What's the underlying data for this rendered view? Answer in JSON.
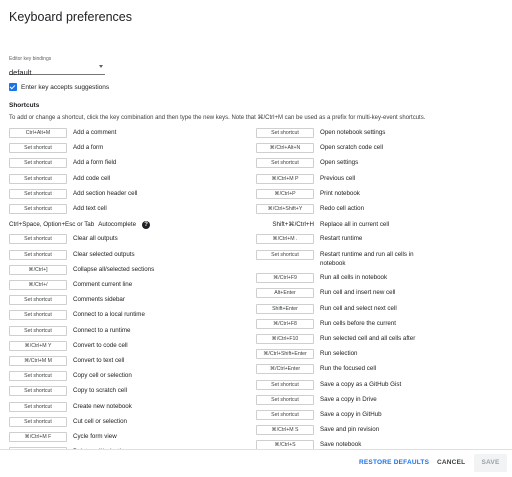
{
  "dialog": {
    "title": "Keyboard preferences",
    "editor_bindings_label": "Editor key bindings",
    "editor_bindings_value": "default",
    "suggestions_label": "Enter key accepts suggestions",
    "shortcuts_heading": "Shortcuts",
    "instructions": "To add or change a shortcut, click the key combination and then type the new keys. Note that ⌘/Ctrl+M can be used as a prefix for multi-key-event shortcuts."
  },
  "left_shortcuts": [
    {
      "key": "Ctrl+Alt+M",
      "label": "Add a comment"
    },
    {
      "key": "Set shortcut",
      "label": "Add a form"
    },
    {
      "key": "Set shortcut",
      "label": "Add a form field"
    },
    {
      "key": "Set shortcut",
      "label": "Add code cell"
    },
    {
      "key": "Set shortcut",
      "label": "Add section header cell"
    },
    {
      "key": "Set shortcut",
      "label": "Add text cell"
    }
  ],
  "autocomplete": {
    "key": "Ctrl+Space, Option+Esc or Tab",
    "label": "Autocomplete"
  },
  "left_shortcuts_2": [
    {
      "key": "Set shortcut",
      "label": "Clear all outputs"
    },
    {
      "key": "Set shortcut",
      "label": "Clear selected outputs"
    },
    {
      "key": "⌘/Ctrl+]",
      "label": "Collapse all/selected sections"
    },
    {
      "key": "⌘/Ctrl+/",
      "label": "Comment current line"
    },
    {
      "key": "Set shortcut",
      "label": "Comments sidebar"
    },
    {
      "key": "Set shortcut",
      "label": "Connect to a local runtime"
    },
    {
      "key": "Set shortcut",
      "label": "Connect to a runtime"
    },
    {
      "key": "⌘/Ctrl+M Y",
      "label": "Convert to code cell"
    },
    {
      "key": "⌘/Ctrl+M M",
      "label": "Convert to text cell"
    },
    {
      "key": "Set shortcut",
      "label": "Copy cell or selection"
    },
    {
      "key": "Set shortcut",
      "label": "Copy to scratch cell"
    },
    {
      "key": "Set shortcut",
      "label": "Create new notebook"
    },
    {
      "key": "Set shortcut",
      "label": "Cut cell or selection"
    },
    {
      "key": "⌘/Ctrl+M F",
      "label": "Cycle form view"
    },
    {
      "key": "⌘/Ctrl+M D",
      "label": "Delete cell/selection"
    }
  ],
  "right_shortcuts": [
    {
      "key": "Set shortcut",
      "label": "Open notebook settings"
    },
    {
      "key": "⌘/Ctrl+Alt+N",
      "label": "Open scratch code cell"
    },
    {
      "key": "Set shortcut",
      "label": "Open settings"
    },
    {
      "key": "⌘/Ctrl+M P",
      "label": "Previous cell"
    },
    {
      "key": "⌘/Ctrl+P",
      "label": "Print notebook"
    },
    {
      "key": "⌘/Ctrl+Shift+Y",
      "label": "Redo cell action"
    }
  ],
  "replace_all": {
    "key": "Shift+⌘/Ctrl+H",
    "label": "Replace all in current cell"
  },
  "right_shortcuts_2": [
    {
      "key": "⌘/Ctrl+M .",
      "label": "Restart runtime"
    },
    {
      "key": "Set shortcut",
      "label": "Restart runtime and run all cells in notebook"
    },
    {
      "key": "⌘/Ctrl+F9",
      "label": "Run all cells in notebook"
    },
    {
      "key": "Alt+Enter",
      "label": "Run cell and insert new cell"
    },
    {
      "key": "Shift+Enter",
      "label": "Run cell and select next cell"
    },
    {
      "key": "⌘/Ctrl+F8",
      "label": "Run cells before the current"
    },
    {
      "key": "⌘/Ctrl+F10",
      "label": "Run selected cell and all cells after"
    },
    {
      "key": "⌘/Ctrl+Shift+Enter",
      "label": "Run selection"
    },
    {
      "key": "⌘/Ctrl+Enter",
      "label": "Run the focused cell"
    },
    {
      "key": "Set shortcut",
      "label": "Save a copy as a GitHub Gist"
    },
    {
      "key": "Set shortcut",
      "label": "Save a copy in Drive"
    },
    {
      "key": "Set shortcut",
      "label": "Save a copy in GitHub"
    },
    {
      "key": "⌘/Ctrl+M S",
      "label": "Save and pin revision"
    },
    {
      "key": "⌘/Ctrl+S",
      "label": "Save notebook"
    }
  ],
  "footer": {
    "restore_label": "RESTORE DEFAULTS",
    "cancel_label": "CANCEL",
    "save_label": "SAVE"
  }
}
